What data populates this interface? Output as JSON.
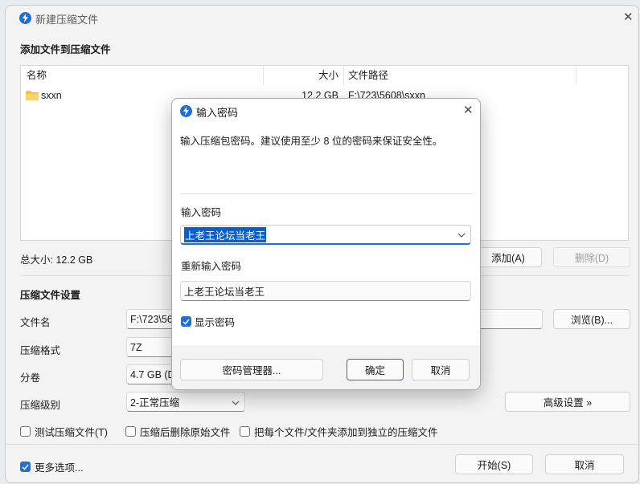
{
  "window": {
    "title": "新建压缩文件",
    "section_title": "添加文件到压缩文件",
    "columns": [
      "名称",
      "大小",
      "文件路径"
    ],
    "files": [
      {
        "name": "sxxn",
        "size": "12.2 GB",
        "path": "F:\\723\\5608\\sxxn",
        "icon": "folder-icon"
      }
    ],
    "total_size": "总大小: 12.2 GB",
    "add_button": "添加(A)",
    "delete_button": "删除(D)",
    "settings_title": "压缩文件设置",
    "filename_label": "文件名",
    "filename_value": "F:\\723\\5608",
    "browse_button": "浏览(B)...",
    "format_label": "压缩格式",
    "format_value": "7Z",
    "volume_label": "分卷",
    "volume_value": "4.7 GB (D",
    "level_label": "压缩级别",
    "level_value": "2-正常压缩",
    "advanced_button": "高级设置 »",
    "test_checkbox": "测试压缩文件(T)",
    "delete_after_checkbox": "压缩后删除原始文件",
    "separate_checkbox": "把每个文件/文件夹添加到独立的压缩文件",
    "more_options_checkbox": "更多选项...",
    "start_button": "开始(S)",
    "cancel_button": "取消"
  },
  "dialog": {
    "title": "输入密码",
    "description": "输入压缩包密码。建议使用至少 8 位的密码来保证安全性。",
    "password_label": "输入密码",
    "password_value": "上老王论坛当老王",
    "confirm_label": "重新输入密码",
    "confirm_value": "上老王论坛当老王",
    "show_password": "显示密码",
    "manager_button": "密码管理器...",
    "ok_button": "确定",
    "cancel_button": "取消"
  },
  "colors": {
    "accent": "#1f6fd6",
    "selection": "#0a5fce",
    "folder": "#f3c242"
  }
}
